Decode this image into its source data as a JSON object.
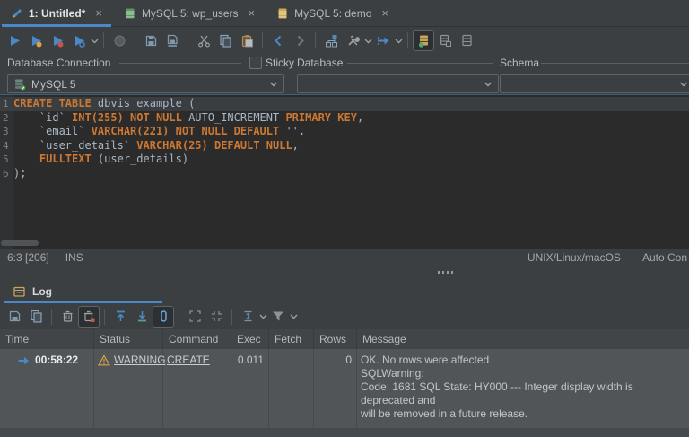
{
  "colors": {
    "accent_blue": "#4A88C7",
    "keyword_orange": "#CC7832",
    "warning_yellow": "#D9A343",
    "editor_bg": "#2b2b2b",
    "panel_bg": "#3c3f41",
    "selected_row_bg": "#515558"
  },
  "tabs": [
    {
      "label": "1: Untitled*",
      "icon": "pencil-icon",
      "close": "×",
      "active": true
    },
    {
      "label": "MySQL 5: wp_users",
      "icon": "table-green-icon",
      "close": "×",
      "active": false
    },
    {
      "label": "MySQL 5: demo",
      "icon": "table-yellow-icon",
      "close": "×",
      "active": false
    }
  ],
  "toolbar": {
    "icons": [
      "execute-icon",
      "execute-current-icon",
      "execute-explain-icon",
      "execute-menu-icon",
      "stop-icon",
      "save-icon",
      "save-as-icon",
      "cut-icon",
      "copy-icon",
      "paste-icon",
      "previous-icon",
      "next-icon",
      "show-in-tree-icon",
      "tools-icon",
      "redirect-output-icon",
      "show-log-grid-icon",
      "grid-save-icon",
      "grid-icon"
    ]
  },
  "connection_bar": {
    "connection_label": "Database Connection",
    "sticky_label": "Sticky",
    "database_label": "Database",
    "schema_label": "Schema",
    "connection_value": "MySQL 5",
    "database_value": "",
    "schema_value": ""
  },
  "editor": {
    "lines": [
      {
        "num": "1",
        "highlight": true,
        "segments": [
          {
            "t": "CREATE TABLE",
            "c": "kw"
          },
          {
            "t": " dbvis_example (",
            "c": "pl"
          }
        ]
      },
      {
        "num": "2",
        "highlight": false,
        "segments": [
          {
            "t": "    `id` ",
            "c": "pl"
          },
          {
            "t": "INT(255) NOT NULL",
            "c": "kw"
          },
          {
            "t": " AUTO_INCREMENT ",
            "c": "pl"
          },
          {
            "t": "PRIMARY KEY",
            "c": "kw"
          },
          {
            "t": ",",
            "c": "pl"
          }
        ]
      },
      {
        "num": "3",
        "highlight": false,
        "segments": [
          {
            "t": "    `email` ",
            "c": "pl"
          },
          {
            "t": "VARCHAR(221) NOT NULL DEFAULT",
            "c": "kw"
          },
          {
            "t": " '',",
            "c": "pl"
          }
        ]
      },
      {
        "num": "4",
        "highlight": false,
        "segments": [
          {
            "t": "    `user_details` ",
            "c": "pl"
          },
          {
            "t": "VARCHAR(25) DEFAULT NULL",
            "c": "kw"
          },
          {
            "t": ",",
            "c": "pl"
          }
        ]
      },
      {
        "num": "5",
        "highlight": false,
        "segments": [
          {
            "t": "    ",
            "c": "pl"
          },
          {
            "t": "FULLTEXT",
            "c": "kw"
          },
          {
            "t": " (user_details)",
            "c": "pl"
          }
        ]
      },
      {
        "num": "6",
        "highlight": false,
        "segments": [
          {
            "t": ");",
            "c": "pl"
          }
        ]
      }
    ]
  },
  "status_bar": {
    "caret": "6:3 [206]",
    "mode": "INS",
    "line_separator": "UNIX/Linux/macOS",
    "auto_commit": "Auto Con"
  },
  "log": {
    "tab_label": "Log",
    "toolbar_icons": [
      "save-log-icon",
      "copy-log-icon",
      "clear-log-icon",
      "clear-on-execute-icon",
      "scroll-top-icon",
      "scroll-bottom-icon",
      "tail-mode-icon",
      "expand-cells-icon",
      "collapse-cells-icon",
      "row-height-icon",
      "filter-icon"
    ],
    "columns": [
      "Time",
      "Status",
      "Command",
      "Exec",
      "Fetch",
      "Rows",
      "Message"
    ],
    "rows": [
      {
        "time": "00:58:22",
        "status": "WARNING",
        "command": "CREATE",
        "exec": "0.011",
        "fetch": "",
        "rows": "0",
        "message_lines": [
          "OK. No rows were affected",
          "SQLWarning:",
          "Code: 1681 SQL State: HY000 --- Integer display width is deprecated and",
          "will be removed in a future release."
        ]
      }
    ]
  }
}
